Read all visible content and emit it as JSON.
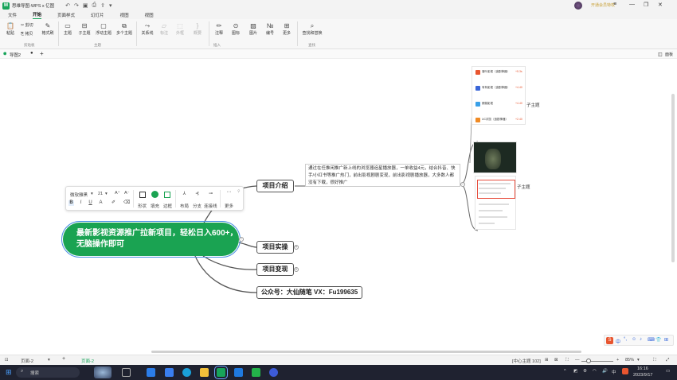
{
  "app": {
    "title": "思维导图-WPS x 亿图",
    "login_tip": "开通会员特权"
  },
  "menu": {
    "tabs": [
      {
        "label": "文件",
        "active": false
      },
      {
        "label": "开始",
        "active": true
      },
      {
        "label": "页面样式",
        "active": false
      },
      {
        "label": "幻灯片",
        "active": false
      },
      {
        "label": "视图",
        "active": false
      },
      {
        "label": "视图",
        "active": false
      }
    ]
  },
  "ribbon": {
    "paste": "粘贴",
    "cut": "剪切",
    "copy": "拷贝",
    "format_brush": "格式刷",
    "topic": "主题",
    "subtopic": "子主题",
    "float_topic": "浮动主题",
    "multi_topic": "多个主题",
    "relation": "关系线",
    "callout": "标注",
    "outline": "外框",
    "summary": "概要",
    "note": "注释",
    "icon": "图标",
    "image": "图片",
    "number": "编号",
    "more": "更多",
    "find_replace": "查找和替换",
    "group_clipboard": "剪贴板",
    "group_topic": "主题",
    "group_insert": "插入",
    "group_find": "查找"
  },
  "doc_tabs": {
    "active_tab": "导图2",
    "outline_label": "面板"
  },
  "mindmap": {
    "root": "最新影视资源推广拉新项目，轻松日入600+，无脑操作即可",
    "branches": [
      {
        "label": "项目介绍"
      },
      {
        "label": "项目实操"
      },
      {
        "label": "项目变现"
      },
      {
        "label": "公众号：大仙随笔 VX：Fu199635"
      }
    ],
    "note": "通过在任推闲推广新上线的浏览器追星播放器，一单收益4元，结合抖音、快手/小红书等推广热门，前出影视剧剧变现，前出影视剧播放器，大多数人都没有下载，很好推广",
    "side_labels": [
      "子主题",
      "子主题"
    ]
  },
  "format_toolbar": {
    "font": "微软雅黑",
    "size": "21",
    "shape": "形状",
    "fill": "填充",
    "border": "边框",
    "layout": "布局",
    "branch": "分支",
    "connector": "连接线",
    "more": "更多",
    "bold": "B",
    "italic": "I",
    "underline": "U",
    "font_color": "A"
  },
  "right_cards": {
    "rows": [
      {
        "title": "落叶影视（追剧神器）",
        "value": "+5.3s"
      },
      {
        "title": "有有影视（追剧神器）",
        "value": "+4.40"
      },
      {
        "title": "蜻蜓影视",
        "value": "+4.40"
      },
      {
        "title": "UC浏览（追剧神器）",
        "value": "+2.40"
      }
    ]
  },
  "statusbar": {
    "page_menu": "页面-2",
    "page_tab": "页面-2",
    "selection": "[中心主题 102]",
    "zoom": "85%"
  },
  "taskbar": {
    "search": "搜索",
    "time": "16:16",
    "date": "2023/9/17",
    "ime_lang": "中"
  },
  "colors": {
    "brand": "#17a45a",
    "root_fill": "#1aa352",
    "taskbar": "#1f2230"
  }
}
